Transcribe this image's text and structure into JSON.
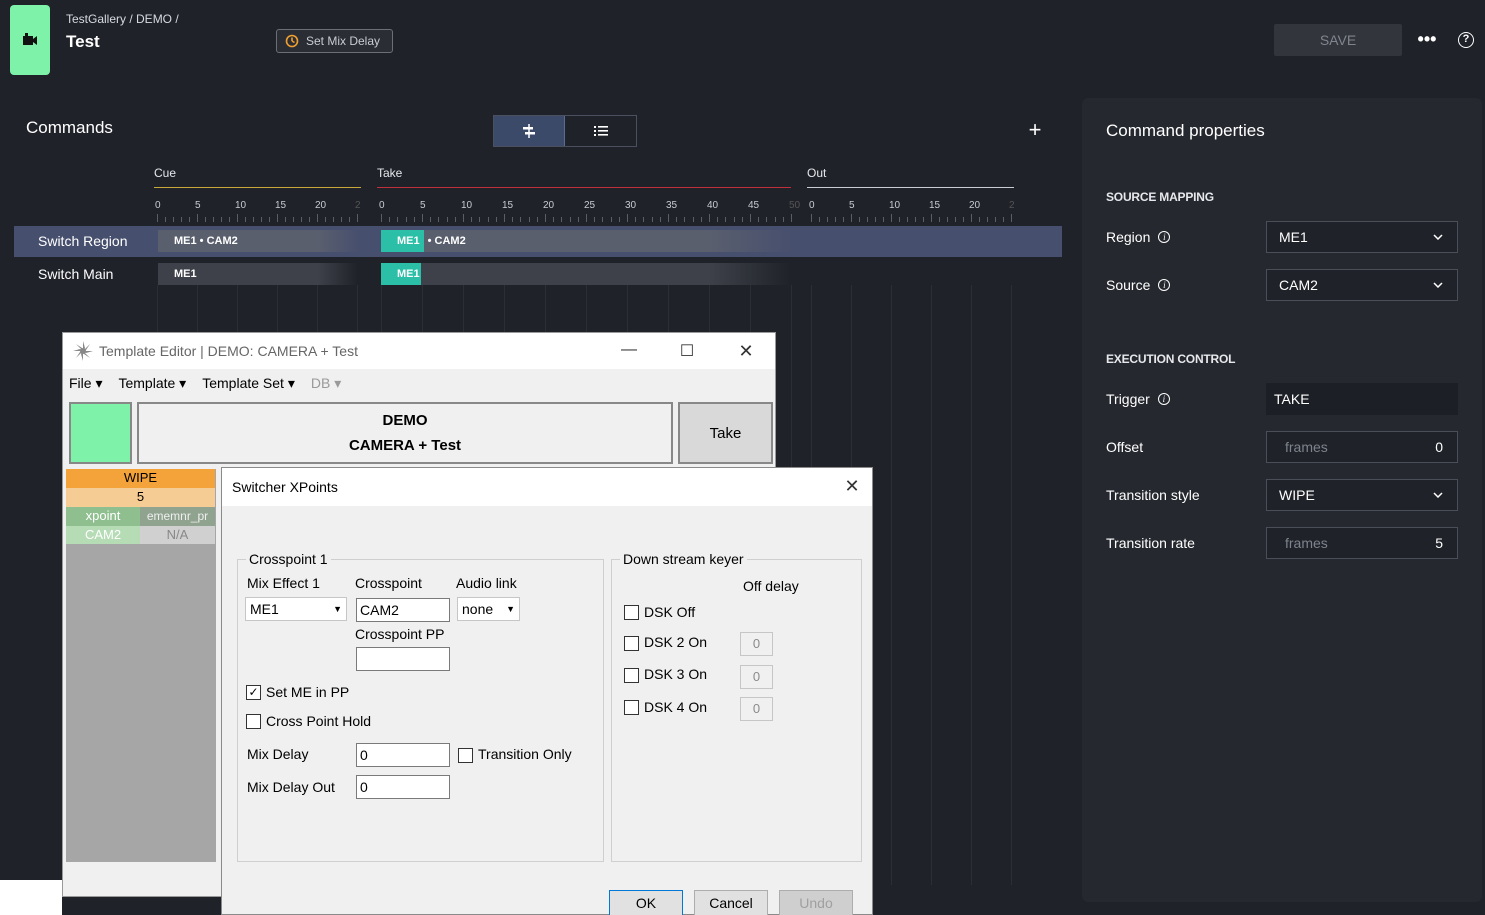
{
  "header": {
    "breadcrumb": "TestGallery / DEMO /",
    "title": "Test",
    "mix_delay_label": "Set Mix Delay",
    "save_label": "SAVE",
    "more_label": "•••",
    "help_label": "?"
  },
  "commands": {
    "title": "Commands",
    "add_label": "+",
    "phases": [
      {
        "label": "Cue",
        "ticks": [
          "0",
          "5",
          "10",
          "15",
          "20",
          "2"
        ]
      },
      {
        "label": "Take",
        "ticks": [
          "0",
          "5",
          "10",
          "15",
          "20",
          "25",
          "30",
          "35",
          "40",
          "45",
          "50"
        ]
      },
      {
        "label": "Out",
        "ticks": [
          "0",
          "5",
          "10",
          "15",
          "20",
          "2"
        ]
      }
    ],
    "rows": [
      {
        "label": "Switch Region",
        "cue_text": "ME1 • CAM2",
        "take_chip": "ME1",
        "take_text": "• CAM2"
      },
      {
        "label": "Switch Main",
        "cue_text": "ME1",
        "take_chip": "ME1",
        "take_text": ""
      }
    ]
  },
  "properties": {
    "title": "Command properties",
    "source_mapping": "SOURCE MAPPING",
    "execution_control": "EXECUTION CONTROL",
    "region_label": "Region",
    "region_value": "ME1",
    "source_label": "Source",
    "source_value": "CAM2",
    "trigger_label": "Trigger",
    "trigger_value": "TAKE",
    "offset_label": "Offset",
    "offset_unit": "frames",
    "offset_value": "0",
    "transition_style_label": "Transition style",
    "transition_style_value": "WIPE",
    "transition_rate_label": "Transition rate",
    "transition_rate_unit": "frames",
    "transition_rate_value": "5"
  },
  "template_editor": {
    "title": "Template Editor | DEMO: CAMERA + Test",
    "menu": [
      "File",
      "Template",
      "Template Set",
      "DB"
    ],
    "header_line1": "DEMO",
    "header_line2": "CAMERA + Test",
    "take_label": "Take",
    "grid": {
      "wipe": "WIPE",
      "rate": "5",
      "col1": "xpoint",
      "col2": "ememnr_pr",
      "val1": "CAM2",
      "val2": "N/A"
    }
  },
  "switcher": {
    "title": "Switcher XPoints",
    "crosspoint_group": "Crosspoint 1",
    "mix_effect_label": "Mix Effect 1",
    "mix_effect_value": "ME1",
    "crosspoint_label": "Crosspoint",
    "crosspoint_value": "CAM2",
    "audio_link_label": "Audio link",
    "audio_link_value": "none",
    "crosspoint_pp_label": "Crosspoint PP",
    "crosspoint_pp_value": "",
    "set_me_pp_label": "Set ME in PP",
    "cross_point_hold_label": "Cross Point Hold",
    "mix_delay_label": "Mix Delay",
    "mix_delay_value": "0",
    "transition_only_label": "Transition Only",
    "mix_delay_out_label": "Mix Delay Out",
    "mix_delay_out_value": "0",
    "dsk_group": "Down stream keyer",
    "off_delay_label": "Off delay",
    "dsk_off_label": "DSK Off",
    "dsk2_label": "DSK 2 On",
    "dsk2_value": "0",
    "dsk3_label": "DSK 3 On",
    "dsk3_value": "0",
    "dsk4_label": "DSK 4 On",
    "dsk4_value": "0",
    "ok_label": "OK",
    "cancel_label": "Cancel",
    "undo_label": "Undo"
  },
  "colors": {
    "accent_green": "#7df2a8",
    "teal_chip": "#2bbfa8",
    "cue_line": "#c8a838",
    "take_line": "#c0303a",
    "out_line": "#c9ccd2"
  }
}
